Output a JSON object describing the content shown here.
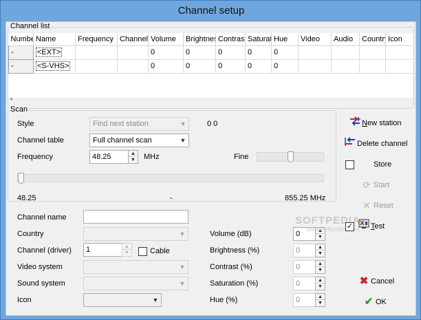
{
  "window": {
    "title": "Channel setup"
  },
  "channel_list": {
    "group_title": "Channel list",
    "columns": [
      "Number",
      "Name",
      "Frequency",
      "Channel",
      "Volume",
      "Brightness",
      "Contrast",
      "Saturation",
      "Hue",
      "Video",
      "Audio",
      "Country",
      "Icon"
    ],
    "rows": [
      {
        "number": "-",
        "name": "<EXT>",
        "frequency": "",
        "channel": "",
        "volume": "0",
        "brightness": "0",
        "contrast": "0",
        "saturation": "0",
        "hue": "0",
        "video": "",
        "audio": "",
        "country": "",
        "icon": ""
      },
      {
        "number": "-",
        "name": "<S-VHS>",
        "frequency": "",
        "channel": "",
        "volume": "0",
        "brightness": "0",
        "contrast": "0",
        "saturation": "0",
        "hue": "0",
        "video": "",
        "audio": "",
        "country": "",
        "icon": ""
      }
    ]
  },
  "scan": {
    "group_title": "Scan",
    "style_label": "Style",
    "style_value": "Find next station",
    "style_counter": "0 0",
    "channel_table_label": "Channel table",
    "channel_table_value": "Full channel scan",
    "frequency_label": "Frequency",
    "frequency_value": "48.25",
    "frequency_unit": "MHz",
    "fine_label": "Fine",
    "fine_level": 0.5,
    "freq_slider_level": 0.0,
    "range_min": "48.25",
    "range_mid": "-",
    "range_max": "855.25 MHz"
  },
  "details": {
    "channel_name_label": "Channel name",
    "channel_name_value": "",
    "country_label": "Country",
    "country_value": "",
    "channel_driver_label": "Channel (driver)",
    "channel_driver_value": "1",
    "cable_label": "Cable",
    "cable_checked": false,
    "video_system_label": "Video system",
    "sound_system_label": "Sound system",
    "icon_label": "Icon",
    "volume_label": "Volume (dB)",
    "volume_value": "0",
    "brightness_label": "Brightness (%)",
    "brightness_value": "0",
    "contrast_label": "Contrast (%)",
    "contrast_value": "0",
    "saturation_label": "Saturation (%)",
    "saturation_value": "0",
    "hue_label": "Hue (%)",
    "hue_value": "0"
  },
  "actions": {
    "new_station_mnemonic": "N",
    "new_station_rest": "ew station",
    "delete_channel": "Delete channel",
    "store_label": "Store",
    "store_checked": false,
    "start_label": "Start",
    "reset_label": "Reset",
    "test_mnemonic": "T",
    "test_rest": "est",
    "test_checked": true,
    "cancel_label": "Cancel",
    "ok_label": "OK"
  },
  "watermark": {
    "text": "SOFTPEDIA",
    "subtext": "www.softpedia.com"
  },
  "colors": {
    "titlebar": "#6fa6dd",
    "client_bg": "#f0f0f0",
    "cancel_icon": "#c0302a",
    "ok_icon": "#2f9a2f",
    "new_station_icon_red": "#d02020",
    "new_station_icon_blue": "#2040c0"
  }
}
